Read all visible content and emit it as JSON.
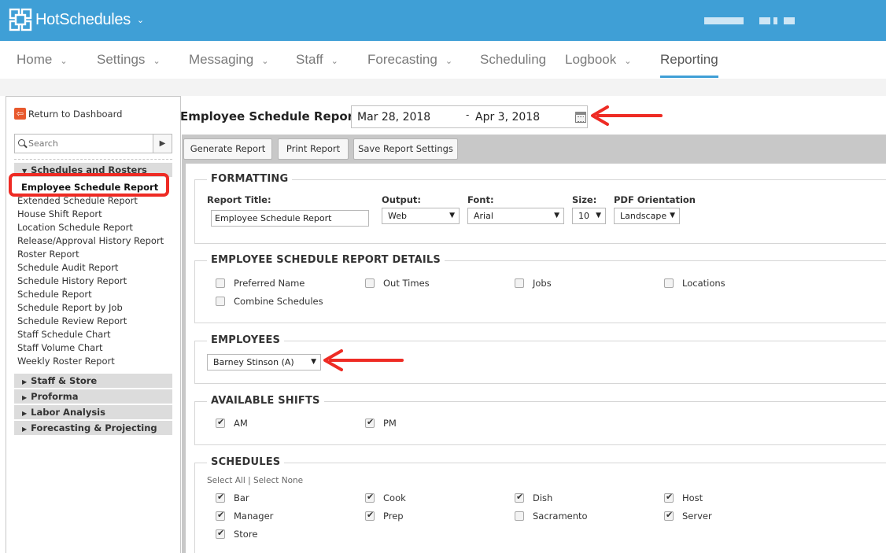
{
  "app": {
    "logo_text": "HotSchedules",
    "brand_color": "#3f9fd6"
  },
  "nav": {
    "items": [
      {
        "label": "Home",
        "has_caret": true
      },
      {
        "label": "Settings",
        "has_caret": true
      },
      {
        "label": "Messaging",
        "has_caret": true
      },
      {
        "label": "Staff",
        "has_caret": true
      },
      {
        "label": "Forecasting",
        "has_caret": true
      },
      {
        "label": "Scheduling",
        "has_caret": false
      },
      {
        "label": "Logbook",
        "has_caret": true
      },
      {
        "label": "Reporting",
        "has_caret": false,
        "active": true
      }
    ],
    "caret": "⌄"
  },
  "sidebar": {
    "return_label": "Return to Dashboard",
    "search_placeholder": "Search",
    "groups": [
      {
        "label": "Schedules and Rosters",
        "expanded": true
      },
      {
        "label": "Staff & Store",
        "expanded": false
      },
      {
        "label": "Proforma",
        "expanded": false
      },
      {
        "label": "Labor Analysis",
        "expanded": false
      },
      {
        "label": "Forecasting & Projecting",
        "expanded": false
      }
    ],
    "items": [
      {
        "label": "Employee Schedule Report",
        "active": true
      },
      {
        "label": "Extended Schedule Report"
      },
      {
        "label": "House Shift Report"
      },
      {
        "label": "Location Schedule Report"
      },
      {
        "label": "Release/Approval History Report"
      },
      {
        "label": "Roster Report"
      },
      {
        "label": "Schedule Audit Report"
      },
      {
        "label": "Schedule History Report"
      },
      {
        "label": "Schedule Report"
      },
      {
        "label": "Schedule Report by Job"
      },
      {
        "label": "Schedule Review Report"
      },
      {
        "label": "Staff Schedule Chart"
      },
      {
        "label": "Staff Volume Chart"
      },
      {
        "label": "Weekly Roster Report"
      }
    ]
  },
  "main": {
    "title": "Employee Schedule Report",
    "date_start": "Mar 28, 2018",
    "date_separator": "-",
    "date_end": "Apr 3, 2018",
    "buttons": {
      "generate": "Generate Report",
      "print": "Print Report",
      "save": "Save Report Settings"
    }
  },
  "formatting": {
    "title": "FORMATTING",
    "report_title_label": "Report Title:",
    "report_title_value": "Employee Schedule Report",
    "output_label": "Output:",
    "output_value": "Web",
    "font_label": "Font:",
    "font_value": "Arial",
    "size_label": "Size:",
    "size_value": "10",
    "orientation_label": "PDF Orientation",
    "orientation_value": "Landscape"
  },
  "details": {
    "title": "EMPLOYEE SCHEDULE REPORT DETAILS",
    "options": [
      {
        "label": "Preferred Name",
        "checked": false
      },
      {
        "label": "Out Times",
        "checked": false
      },
      {
        "label": "Jobs",
        "checked": false
      },
      {
        "label": "Locations",
        "checked": false
      },
      {
        "label": "Combine Schedules",
        "checked": false
      }
    ]
  },
  "employees": {
    "title": "EMPLOYEES",
    "selected": "Barney Stinson (A)"
  },
  "shifts": {
    "title": "AVAILABLE SHIFTS",
    "options": [
      {
        "label": "AM",
        "checked": true
      },
      {
        "label": "PM",
        "checked": true
      }
    ]
  },
  "schedules": {
    "title": "SCHEDULES",
    "select_all": "Select All",
    "divider": "|",
    "select_none": "Select None",
    "options": [
      {
        "label": "Bar",
        "checked": true
      },
      {
        "label": "Cook",
        "checked": true
      },
      {
        "label": "Dish",
        "checked": true
      },
      {
        "label": "Host",
        "checked": true
      },
      {
        "label": "Manager",
        "checked": true
      },
      {
        "label": "Prep",
        "checked": true
      },
      {
        "label": "Sacramento",
        "checked": false
      },
      {
        "label": "Server",
        "checked": true
      },
      {
        "label": "Store",
        "checked": true
      }
    ]
  },
  "annotation_color": "#ee2b24"
}
